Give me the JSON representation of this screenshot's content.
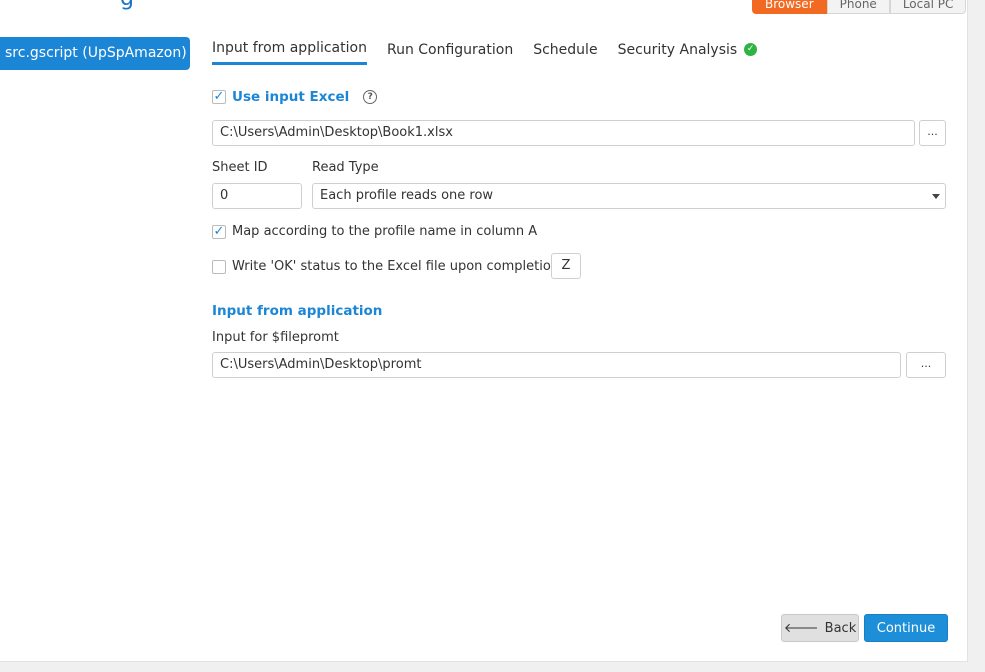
{
  "header": {
    "title_fragment": "g",
    "mode_segments": [
      "Browser",
      "Phone",
      "Local PC"
    ],
    "active_mode": "Browser"
  },
  "sidebar": {
    "items": [
      {
        "label": "src.gscript  (UpSpAmazon)"
      }
    ]
  },
  "tabs": [
    {
      "label": "Input from application",
      "active": true
    },
    {
      "label": "Run Configuration"
    },
    {
      "label": "Schedule"
    },
    {
      "label": "Security Analysis",
      "status_icon": "check-circle-icon"
    }
  ],
  "excel": {
    "use_input_label": "Use input Excel",
    "use_input_checked": true,
    "file_path": "C:\\Users\\Admin\\Desktop\\Book1.xlsx",
    "browse_label": "...",
    "sheet_id_label": "Sheet ID",
    "sheet_id_value": "0",
    "read_type_label": "Read Type",
    "read_type_value": "Each profile reads one row",
    "map_label": "Map according to the profile name in column A",
    "map_checked": true,
    "write_ok_label": "Write 'OK' status to the Excel file upon completion",
    "write_ok_checked": false,
    "write_ok_column": "Z"
  },
  "app_input": {
    "section_title": "Input from application",
    "field_label": "Input for $filepromt",
    "field_value": "C:\\Users\\Admin\\Desktop\\promt",
    "browse_label": "..."
  },
  "footer": {
    "back_label": "Back",
    "continue_label": "Continue"
  },
  "colors": {
    "accent": "#1c86d6",
    "active_mode": "#f26a21",
    "success": "#2fb344"
  }
}
